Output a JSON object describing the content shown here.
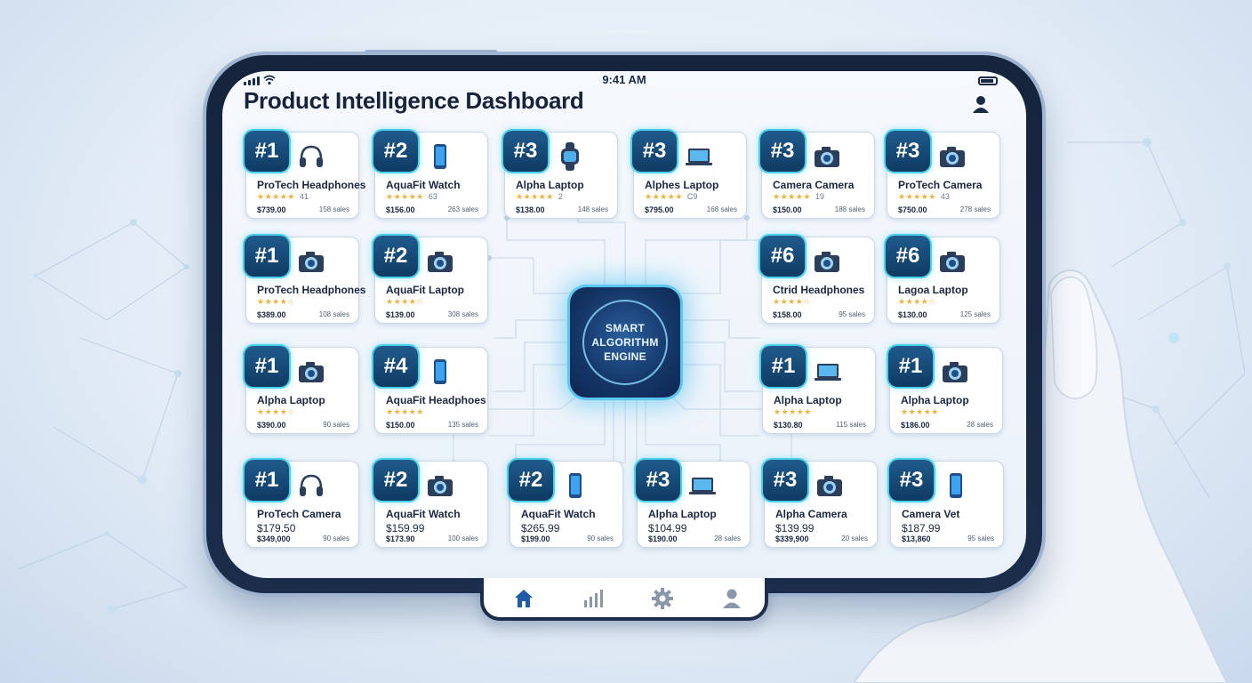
{
  "status": {
    "time": "9:41 AM"
  },
  "header": {
    "title": "Product Intelligence Dashboard"
  },
  "engine": {
    "line1": "SMART",
    "line2": "ALGORITHM",
    "line3": "ENGINE"
  },
  "cards": [
    {
      "rank": "#1",
      "icon": "headphones-icon",
      "name": "ProTech Headphones",
      "rating": 4.5,
      "reviews": "41",
      "price": "$739.00",
      "sales": "158 sales"
    },
    {
      "rank": "#2",
      "icon": "phone-icon",
      "name": "AquaFit Watch",
      "rating": 4.5,
      "reviews": "63",
      "price": "$156.00",
      "sales": "263 sales"
    },
    {
      "rank": "#3",
      "icon": "watch-icon",
      "name": "Alpha Laptop",
      "rating": 4.5,
      "reviews": "2",
      "price": "$138.00",
      "sales": "148 sales"
    },
    {
      "rank": "#3",
      "icon": "laptop-icon",
      "name": "Alphes Laptop",
      "rating": 4.5,
      "reviews": "C9",
      "price": "$795.00",
      "sales": "168 sales"
    },
    {
      "rank": "#3",
      "icon": "camera-icon",
      "name": "Camera Camera",
      "rating": 4.5,
      "reviews": "19",
      "price": "$150.00",
      "sales": "188 sales"
    },
    {
      "rank": "#3",
      "icon": "camera-icon",
      "name": "ProTech Camera",
      "rating": 4.5,
      "reviews": "43",
      "price": "$750.00",
      "sales": "278 sales"
    },
    {
      "rank": "#1",
      "icon": "camera-icon",
      "name": "ProTech Headphones",
      "rating": 4,
      "reviews": "",
      "price": "$389.00",
      "sales": "108 sales"
    },
    {
      "rank": "#2",
      "icon": "camera-icon",
      "name": "AquaFit Laptop",
      "rating": 4,
      "reviews": "",
      "price": "$139.00",
      "sales": "308 sales"
    },
    {
      "rank": "#6",
      "icon": "camera-icon",
      "name": "Ctrid Headphones",
      "rating": 4,
      "reviews": "",
      "price": "$158.00",
      "sales": "95 sales"
    },
    {
      "rank": "#6",
      "icon": "camera-icon",
      "name": "Lagoa Laptop",
      "rating": 4,
      "reviews": "",
      "price": "$130.00",
      "sales": "125 sales"
    },
    {
      "rank": "#1",
      "icon": "camera-icon",
      "name": "Alpha Laptop",
      "rating": 3.5,
      "reviews": "",
      "price": "$390.00",
      "sales": "90 sales"
    },
    {
      "rank": "#4",
      "icon": "phone-icon",
      "name": "AquaFit Headphoes",
      "rating": 4.5,
      "reviews": "",
      "price": "$150.00",
      "sales": "135 sales"
    },
    {
      "rank": "#1",
      "icon": "laptop-icon",
      "name": "Alpha Laptop",
      "rating": 4.5,
      "reviews": "",
      "price": "$130.80",
      "sales": "115 sales"
    },
    {
      "rank": "#1",
      "icon": "camera-icon",
      "name": "Alpha Laptop",
      "rating": 4.5,
      "reviews": "",
      "price": "$186.00",
      "sales": "28 sales"
    },
    {
      "rank": "#1",
      "icon": "headphones-icon",
      "name": "ProTech Camera",
      "big_price": "$179.50",
      "price": "$349,000",
      "sales": "90 sales"
    },
    {
      "rank": "#2",
      "icon": "camera-icon",
      "name": "AquaFit Watch",
      "big_price": "$159.99",
      "price": "$173.90",
      "sales": "100 sales"
    },
    {
      "rank": "#2",
      "icon": "phone-icon",
      "name": "AquaFit Watch",
      "big_price": "$265.99",
      "price": "$199.00",
      "sales": "90 sales"
    },
    {
      "rank": "#3",
      "icon": "laptop-icon",
      "name": "Alpha Laptop",
      "big_price": "$104.99",
      "price": "$190.00",
      "sales": "28 sales"
    },
    {
      "rank": "#3",
      "icon": "camera-icon",
      "name": "Alpha Camera",
      "big_price": "$139.99",
      "price": "$339,900",
      "sales": "20 sales"
    },
    {
      "rank": "#3",
      "icon": "phone-icon",
      "name": "Camera Vet",
      "big_price": "$187.99",
      "price": "$13,860",
      "sales": "95 sales"
    }
  ],
  "nav": [
    {
      "icon": "home-icon",
      "active": true
    },
    {
      "icon": "chart-icon",
      "active": false
    },
    {
      "icon": "gear-icon",
      "active": false
    },
    {
      "icon": "user-icon",
      "active": false
    }
  ],
  "colors": {
    "accent": "#48d0ee",
    "navy": "#16243d",
    "star": "#f0b23a",
    "active_nav": "#1e5ea8"
  }
}
